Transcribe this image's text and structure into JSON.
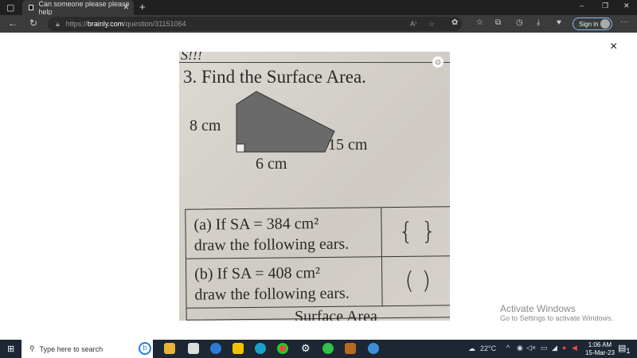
{
  "browser": {
    "tab_title": "Can someone please please help",
    "url_prefix": "https://",
    "url_domain": "brainly.com",
    "url_path": "/question/31151064",
    "signin_label": "Sign in",
    "more": "···"
  },
  "photo": {
    "top_fragment": "S!!!",
    "title": "3. Find the Surface Area.",
    "labels": [
      "8 cm",
      "15 cm",
      "6 cm"
    ],
    "rows": [
      {
        "line1": "(a) If SA = 384 cm²",
        "line2": "draw the following ears.",
        "answer": "{ }"
      },
      {
        "line1": "(b) If SA = 408 cm²",
        "line2": "draw the following ears.",
        "answer": "( )"
      }
    ],
    "bottom_fragment": "Surface Area"
  },
  "overlay": {
    "close": "×"
  },
  "watermark": {
    "title": "Activate Windows",
    "subtitle": "Go to Settings to activate Windows."
  },
  "taskbar": {
    "search_placeholder": "Type here to search",
    "temperature": "22°C",
    "time": "1:06 AM",
    "date": "15-Mar-23",
    "notif_count": "1"
  },
  "colors": {
    "taskbar": "#1c2733",
    "titlebar": "#202020",
    "accent": "#8ab4f8"
  }
}
